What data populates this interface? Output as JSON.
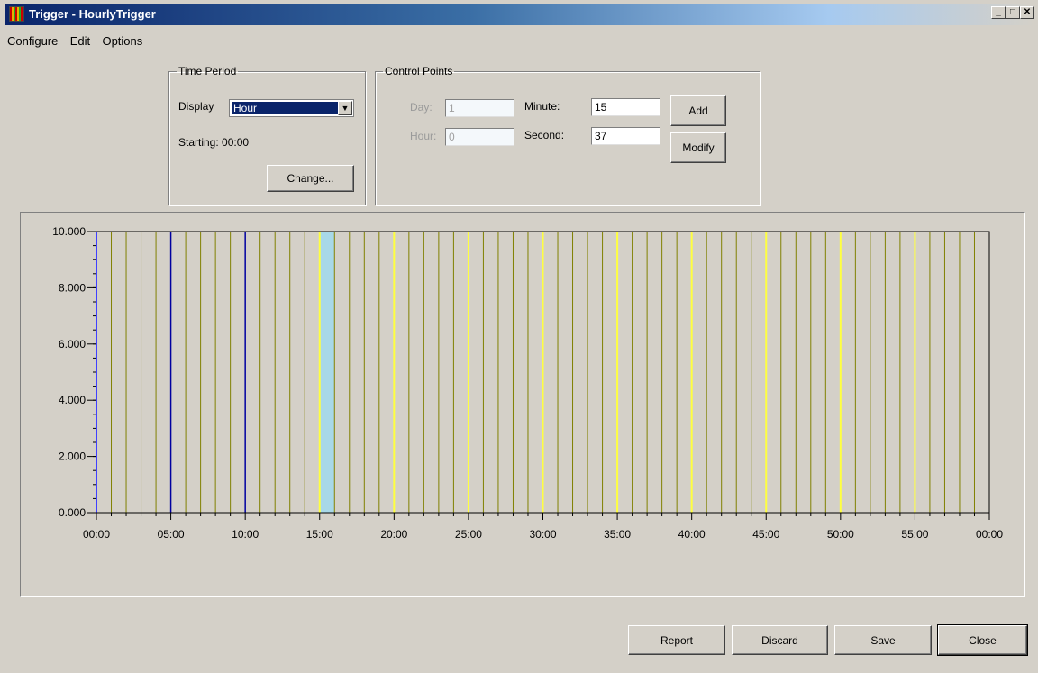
{
  "window": {
    "title": "Trigger - HourlyTrigger"
  },
  "menu": [
    "Configure",
    "Edit",
    "Options"
  ],
  "time_period": {
    "legend": "Time Period",
    "display_label": "Display",
    "display_value": "Hour",
    "starting_text": "Starting: 00:00",
    "change_button": "Change..."
  },
  "control_points": {
    "legend": "Control Points",
    "day_label": "Day:",
    "day_value": "1",
    "hour_label": "Hour:",
    "hour_value": "0",
    "minute_label": "Minute:",
    "minute_value": "15",
    "second_label": "Second:",
    "second_value": "37",
    "add_button": "Add",
    "modify_button": "Modify"
  },
  "buttons": {
    "report": "Report",
    "discard": "Discard",
    "save": "Save",
    "close": "Close"
  },
  "chart_data": {
    "type": "bar",
    "y_tick_labels": [
      "0.000",
      "2.000",
      "4.000",
      "6.000",
      "8.000",
      "10.000"
    ],
    "ylim": [
      0,
      10
    ],
    "x_tick_labels": [
      "00:00",
      "05:00",
      "10:00",
      "15:00",
      "20:00",
      "25:00",
      "30:00",
      "35:00",
      "40:00",
      "45:00",
      "50:00",
      "55:00",
      "00:00"
    ],
    "xlim_minutes": [
      0,
      60
    ],
    "bar_minutes": [
      0,
      1,
      2,
      3,
      4,
      5,
      6,
      7,
      8,
      9,
      10,
      11,
      12,
      13,
      14,
      15,
      16,
      17,
      18,
      19,
      20,
      21,
      22,
      23,
      24,
      25,
      26,
      27,
      28,
      29,
      30,
      31,
      32,
      33,
      34,
      35,
      36,
      37,
      38,
      39,
      40,
      41,
      42,
      43,
      44,
      45,
      46,
      47,
      48,
      49,
      50,
      51,
      52,
      53,
      54,
      55,
      56,
      57,
      58,
      59
    ],
    "bar_value": 10,
    "colors": {
      "normal": "#808000",
      "five_minute": "#ffff40",
      "selected": "#0000a0",
      "axis": "#000000",
      "selection_band": "#a8d8e8"
    },
    "selected_minutes": [
      0,
      5,
      10
    ],
    "selection_band_minutes": [
      15,
      16
    ]
  }
}
